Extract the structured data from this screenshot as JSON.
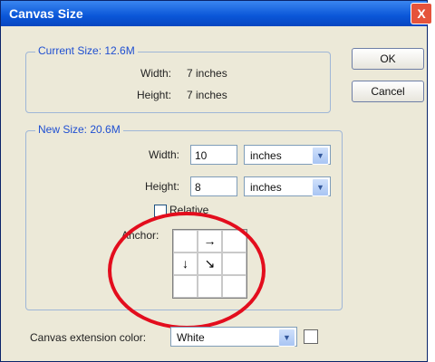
{
  "window": {
    "title": "Canvas Size",
    "close_glyph": "X"
  },
  "current_size": {
    "legend": "Current Size: 12.6M",
    "width_label": "Width:",
    "width_value": "7 inches",
    "height_label": "Height:",
    "height_value": "7 inches"
  },
  "buttons": {
    "ok": "OK",
    "cancel": "Cancel"
  },
  "new_size": {
    "legend": "New Size: 20.6M",
    "width_label": "Width:",
    "width_value": "10",
    "width_unit": "inches",
    "height_label": "Height:",
    "height_value": "8",
    "height_unit": "inches",
    "relative_label": "Relative",
    "anchor_label": "Anchor:",
    "anchor_cells": [
      "",
      "→",
      "",
      "↓",
      "↘",
      "",
      "",
      "",
      ""
    ]
  },
  "extension": {
    "label": "Canvas extension color:",
    "value": "White",
    "swatch_color": "#ffffff"
  },
  "colors": {
    "title_bar": "#0a56d8",
    "accent": "#1f4fd1",
    "annotation_circle": "#e30d1d"
  }
}
